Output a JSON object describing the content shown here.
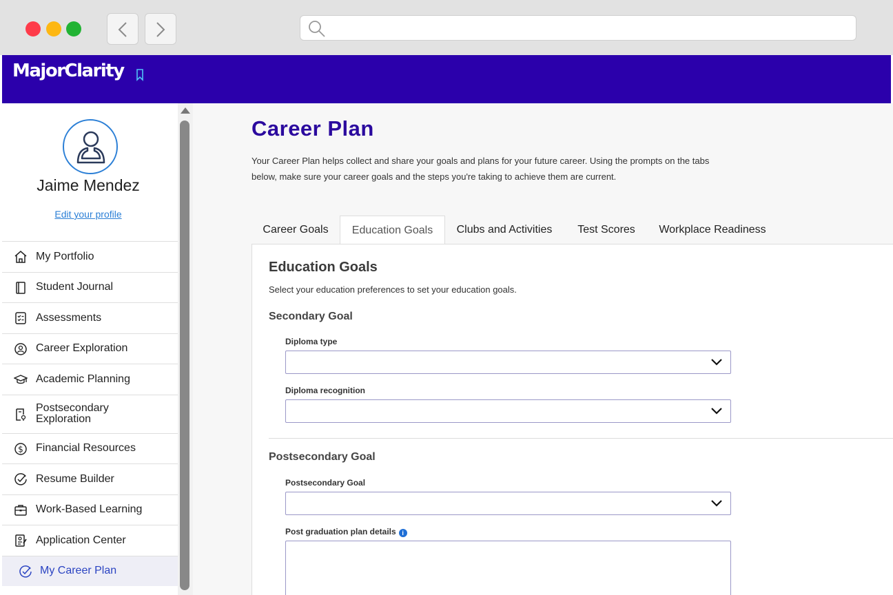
{
  "app": {
    "brand": "MajorClarity",
    "brand_color": "#2b00ab",
    "accent_color": "#2b7fd6"
  },
  "browser": {
    "url": ""
  },
  "profile": {
    "name": "Jaime Mendez",
    "edit_link": "Edit your profile"
  },
  "sidebar": {
    "items": [
      {
        "label": "My Portfolio",
        "icon": "home-icon"
      },
      {
        "label": "Student Journal",
        "icon": "journal-icon"
      },
      {
        "label": "Assessments",
        "icon": "checklist-icon"
      },
      {
        "label": "Career Exploration",
        "icon": "person-badge-icon"
      },
      {
        "label": "Academic Planning",
        "icon": "graduation-cap-icon"
      },
      {
        "label": "Postsecondary Exploration",
        "icon": "document-pin-icon"
      },
      {
        "label": "Financial Resources",
        "icon": "dollar-icon"
      },
      {
        "label": "Resume Builder",
        "icon": "check-circle-icon"
      },
      {
        "label": "Work-Based Learning",
        "icon": "briefcase-icon"
      },
      {
        "label": "Application Center",
        "icon": "application-icon"
      },
      {
        "label": "My Career Plan",
        "icon": "check-circle-icon",
        "active": true
      }
    ]
  },
  "main": {
    "title": "Career Plan",
    "description": "Your Career Plan helps collect and share your goals and plans for your future career. Using the prompts on the tabs below, make sure your career goals and the steps you're taking to achieve them are current.",
    "tabs": [
      {
        "label": "Career Goals"
      },
      {
        "label": "Education Goals",
        "active": true
      },
      {
        "label": "Clubs and Activities"
      },
      {
        "label": "Test Scores"
      },
      {
        "label": "Workplace Readiness"
      }
    ],
    "panel": {
      "title": "Education Goals",
      "subtitle": "Select your education preferences to set your education goals.",
      "secondary": {
        "heading": "Secondary Goal",
        "diploma_type_label": "Diploma type",
        "diploma_type_value": "",
        "diploma_recognition_label": "Diploma recognition",
        "diploma_recognition_value": ""
      },
      "postsecondary": {
        "heading": "Postsecondary Goal",
        "goal_label": "Postsecondary Goal",
        "goal_value": "",
        "details_label": "Post graduation plan details",
        "details_value": ""
      }
    }
  }
}
